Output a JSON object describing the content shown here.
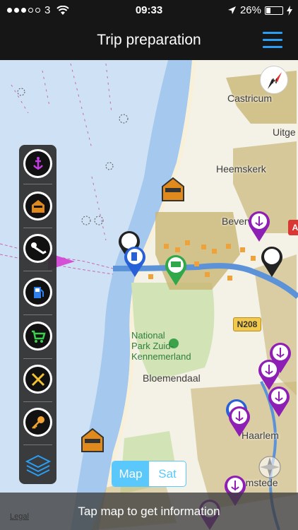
{
  "status_bar": {
    "carrier": "3",
    "time": "09:33",
    "battery": "26%",
    "battery_level": 0.26
  },
  "nav": {
    "title": "Trip preparation"
  },
  "map": {
    "towns": {
      "castricum": "Castricum",
      "uitgeest": "Uitge",
      "heemskerk": "Heemskerk",
      "beverwijk": "Beverwij",
      "bloemendaal": "Bloemendaal",
      "haarlem": "Haarlem",
      "heemstede": "Heemstede"
    },
    "park_lines": [
      "National",
      "Park Zuid-",
      "Kennemerland"
    ],
    "road_label": "N208",
    "a_road_label": "A",
    "legal": "Legal"
  },
  "toolbar": {
    "items": [
      "anchorage-icon",
      "harbor-icon",
      "diving-icon",
      "fuel-icon",
      "shopping-icon",
      "service-icon",
      "key-icon",
      "layers-icon"
    ]
  },
  "map_toggle": {
    "map_label": "Map",
    "sat_label": "Sat",
    "selected": "Map"
  },
  "info_bar": {
    "message": "Tap map to get information"
  },
  "colors": {
    "water": "#a4c8ee",
    "land": "#f4f1e7",
    "urban": "#c9b676",
    "park": "#d2e3b6",
    "accent": "#5ac8fa",
    "toolbar": "#2d2d2d",
    "marker_purple": "#8e1fb4",
    "marker_blue": "#2860d8",
    "marker_green": "#2fa84a"
  }
}
